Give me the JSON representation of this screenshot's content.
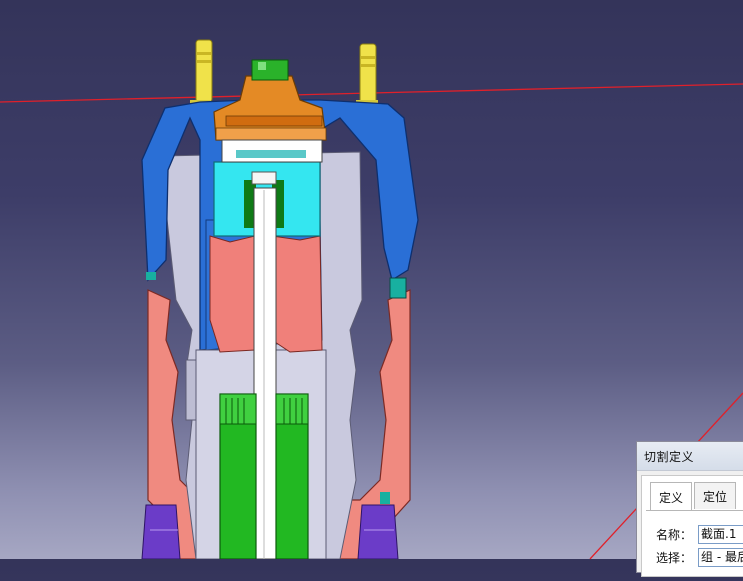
{
  "dialog": {
    "title": "切割定义",
    "tabs": [
      {
        "label": "定义",
        "active": true
      },
      {
        "label": "定位",
        "active": false
      }
    ],
    "fields": {
      "name_label": "名称：",
      "name_value": "截面.1",
      "selection_label": "选择：",
      "selection_value": "组 - 最后"
    }
  },
  "colors": {
    "background_top": "#34345a",
    "background_bottom": "#a6a7c3",
    "section_plane_line": "#e0202a",
    "shell_blue": "#2a6fd6",
    "bellows_red": "#f08a80",
    "cyan": "#34e6f0",
    "green": "#22b822",
    "orange": "#e48a25",
    "yellow": "#f0e24a",
    "purple": "#6b3cc8"
  }
}
